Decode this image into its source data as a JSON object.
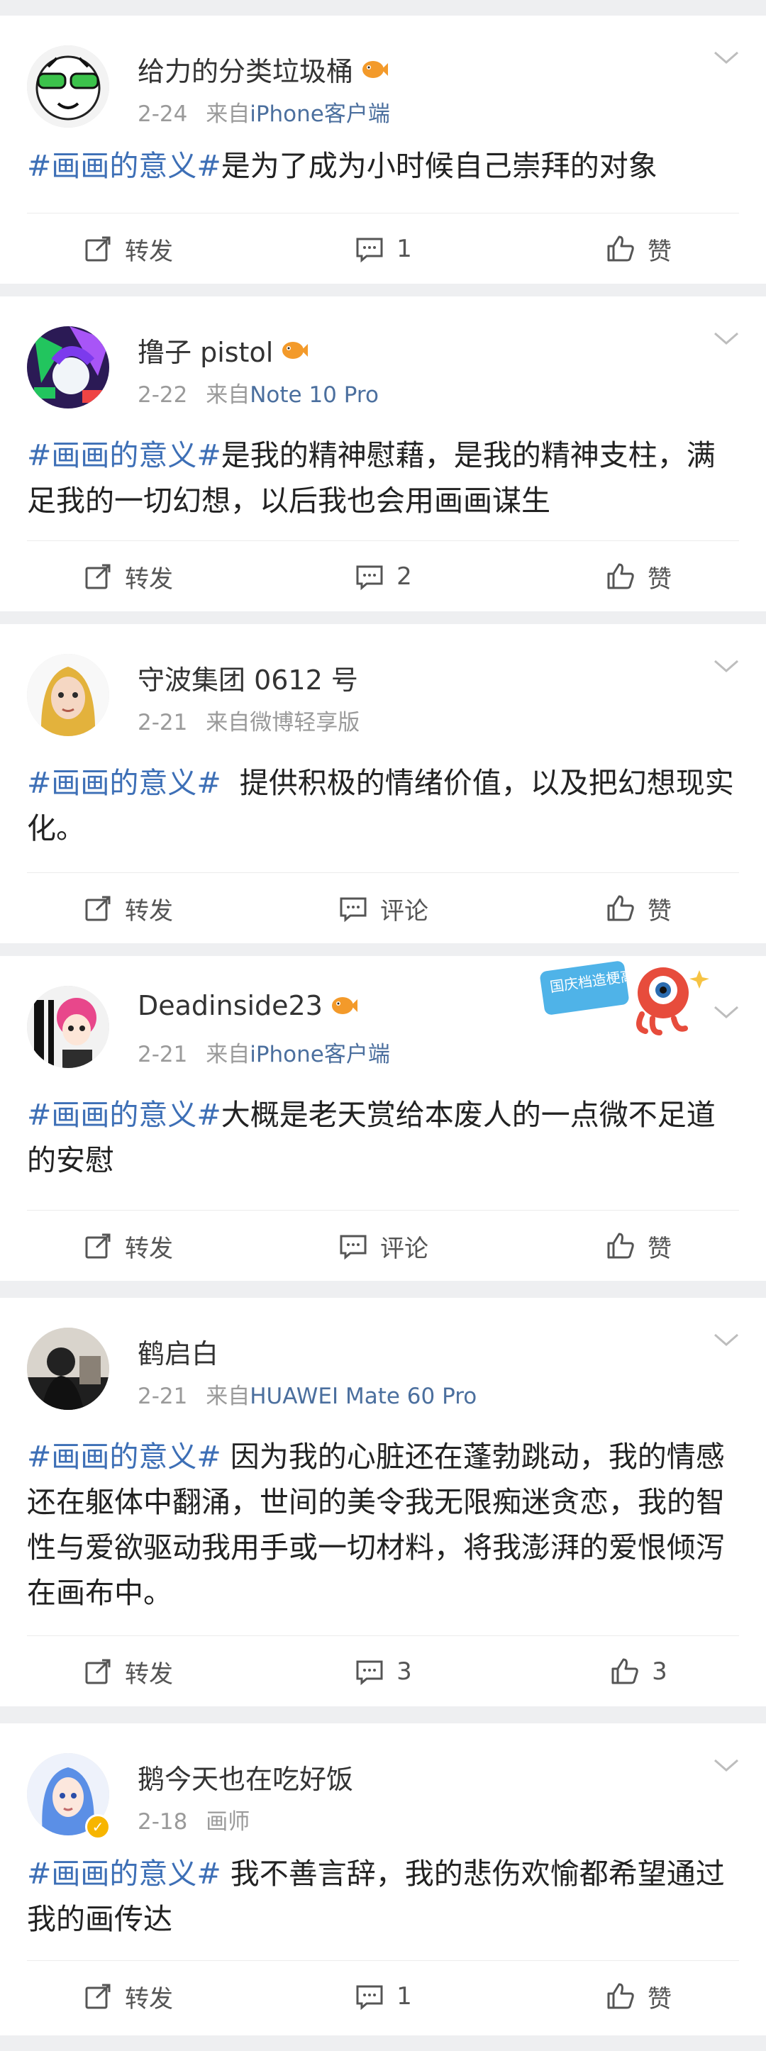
{
  "posts": [
    {
      "name": "给力的分类垃圾桶",
      "date": "2-24",
      "source_prefix": "来自",
      "source": "iPhone客户端",
      "tag": "#画画的意义#",
      "text": "是为了成为小时候自己崇拜的对象",
      "repost": "转发",
      "comment": "1",
      "like": "赞"
    },
    {
      "name": "撸子 pistol",
      "date": "2-22",
      "source_prefix": "来自",
      "source": "Note 10 Pro",
      "tag": "#画画的意义#",
      "text": "是我的精神慰藉，是我的精神支柱，满足我的一切幻想，以后我也会用画画谋生",
      "repost": "转发",
      "comment": "2",
      "like": "赞"
    },
    {
      "name": "守波集团 0612 号",
      "date": "2-21",
      "source_prefix": "来自",
      "source": "微博轻享版",
      "tag": "#画画的意义#",
      "text": "  提供积极的情绪价值，以及把幻想现实化。",
      "repost": "转发",
      "comment": "评论",
      "like": "赞"
    },
    {
      "name": "Deadinside23",
      "date": "2-21",
      "source_prefix": "来自",
      "source": "iPhone客户端",
      "tag": "#画画的意义#",
      "text": "大概是老天赏给本废人的一点微不足道的安慰",
      "sticker_text": "国庆档造梗高手",
      "repost": "转发",
      "comment": "评论",
      "like": "赞"
    },
    {
      "name": "鹤启白",
      "date": "2-21",
      "source_prefix": "来自",
      "source": "HUAWEI Mate 60 Pro",
      "tag": "#画画的意义#",
      "text": " 因为我的心脏还在蓬勃跳动，我的情感还在躯体中翻涌，世间的美令我无限痴迷贪恋，我的智性与爱欲驱动我用手或一切材料，将我澎湃的爱恨倾泻在画布中。",
      "repost": "转发",
      "comment": "3",
      "like": "3"
    },
    {
      "name": "鹅今天也在吃好饭",
      "date": "2-18",
      "source_prefix": "",
      "source": "画师",
      "tag": "#画画的意义#",
      "text": " 我不善言辞，我的悲伤欢愉都希望通过我的画传达",
      "repost": "转发",
      "comment": "1",
      "like": "赞"
    }
  ],
  "colors": {
    "tag": "#3d6fb6",
    "source": "#4b6f9e",
    "meta": "#9a9a9a",
    "background": "#eeeff1"
  },
  "icons": {
    "repost": "repost-icon",
    "comment": "comment-icon",
    "like": "like-icon",
    "menu": "chevron-down-icon",
    "member": "fish-badge-icon"
  }
}
